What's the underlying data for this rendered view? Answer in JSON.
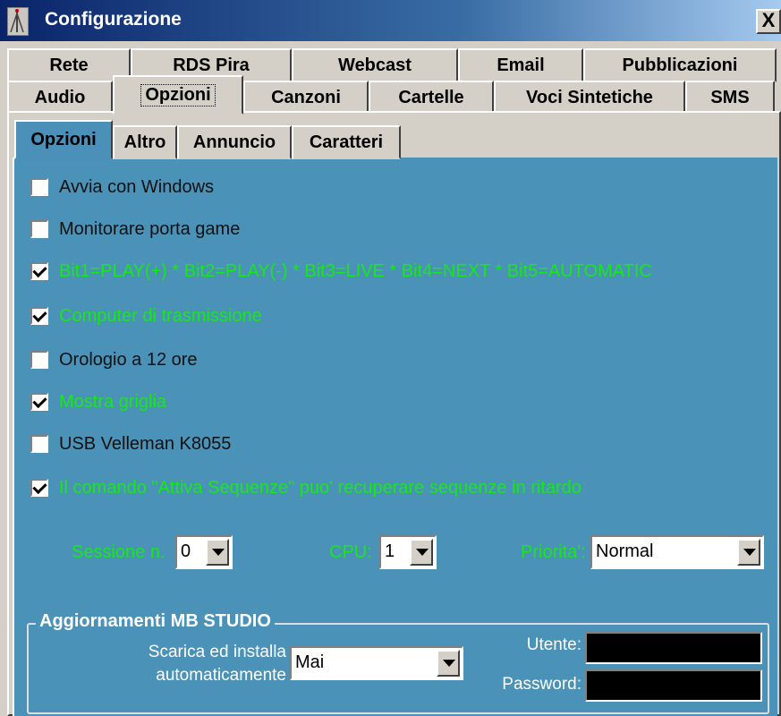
{
  "window": {
    "title": "Configurazione",
    "close_label": "X"
  },
  "tabs_row1": [
    "Rete",
    "RDS Pira",
    "Webcast",
    "Email",
    "Pubblicazioni"
  ],
  "tabs_row2": [
    "Audio",
    "Opzioni",
    "Canzoni",
    "Cartelle",
    "Voci Sintetiche",
    "SMS"
  ],
  "active_tab_row2": "Opzioni",
  "inner_tabs": [
    "Opzioni",
    "Altro",
    "Annuncio",
    "Caratteri"
  ],
  "active_inner_tab": "Opzioni",
  "checkboxes": [
    {
      "label": "Avvia con Windows",
      "checked": false
    },
    {
      "label": "Monitorare porta game",
      "checked": false
    },
    {
      "label": "Bit1=PLAY(+) * Bit2=PLAY(-) * Bit3=LIVE * Bit4=NEXT * Bit5=AUTOMATIC",
      "checked": true
    },
    {
      "label": "Computer di trasmissione",
      "checked": true
    },
    {
      "label": "Orologio a 12 ore",
      "checked": false
    },
    {
      "label": "Mostra griglia",
      "checked": true
    },
    {
      "label": "USB Velleman K8055",
      "checked": false
    },
    {
      "label": "Il comando  \"Attiva Sequenze\" puo' recuperare sequenze in ritardo",
      "checked": true
    }
  ],
  "session": {
    "label": "Sessione n.",
    "value": "0"
  },
  "cpu": {
    "label": "CPU:",
    "value": "1"
  },
  "priority": {
    "label": "Priorita':",
    "value": "Normal"
  },
  "updates": {
    "group_title": "Aggiornamenti MB STUDIO",
    "auto_label_1": "Scarica ed installa",
    "auto_label_2": "automaticamente",
    "auto_value": "Mai",
    "user_label": "Utente:",
    "password_label": "Password:"
  },
  "colors": {
    "panel": "#4a92b8",
    "green_text": "#18e818",
    "titlebar": "#0a246a"
  }
}
